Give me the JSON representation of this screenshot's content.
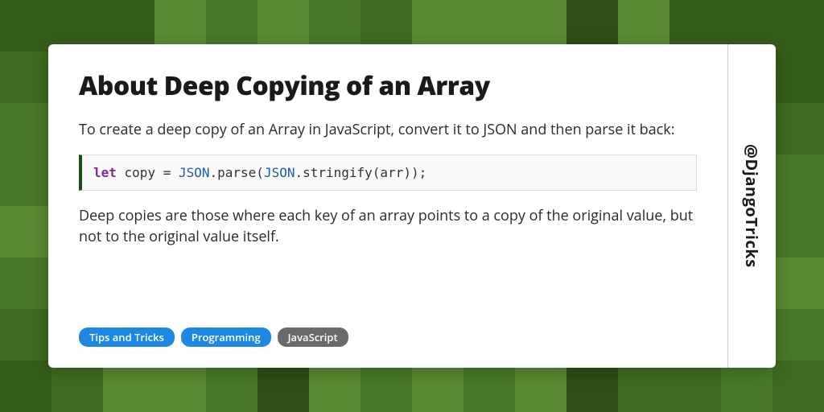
{
  "title": "About Deep Copying of an Array",
  "intro": "To create a deep copy of an Array in JavaScript, convert it to JSON and then parse it back:",
  "code": {
    "keyword": "let",
    "s1": " copy = ",
    "cls1": "JSON",
    "s2": ".parse(",
    "cls2": "JSON",
    "s3": ".stringify(arr));"
  },
  "explanation": "Deep copies are those where each key of an array points to a copy of the original value, but not to the original value itself.",
  "tags": [
    {
      "label": "Tips and Tricks",
      "variant": "blue"
    },
    {
      "label": "Programming",
      "variant": "blue"
    },
    {
      "label": "JavaScript",
      "variant": "gray"
    }
  ],
  "handle": "@DjangoTricks"
}
